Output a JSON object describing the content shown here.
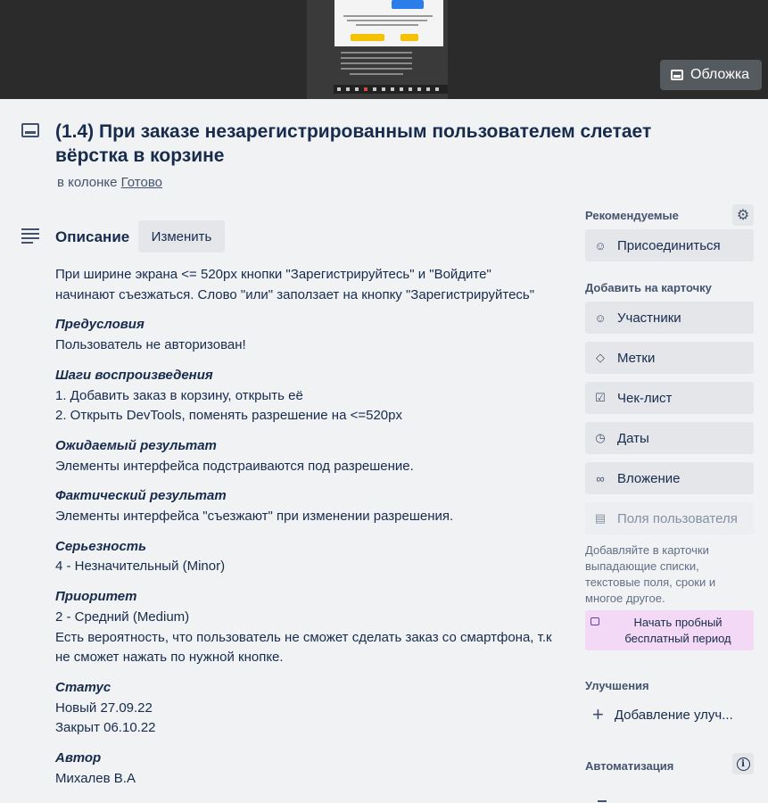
{
  "cover": {
    "button_label": "Обложка",
    "button_icon": "card-cover-icon"
  },
  "card": {
    "title": "(1.4) При заказе незарегистрированным пользователем слетает вёрстка в корзине",
    "in_list_prefix": "в колонке",
    "list_name": "Готово"
  },
  "description": {
    "label": "Описание",
    "edit_label": "Изменить",
    "intro_line1": "При ширине экрана <= 520px кнопки \"Зарегистрируйтесь\" и \"Войдите\"",
    "intro_line2": "начинают съезжаться. Слово \"или\" заползает на кнопку \"Зарегистрируйтесь\"",
    "preconditions_h": "Предусловия",
    "preconditions": "Пользователь не авторизован!",
    "steps_h": "Шаги воспроизведения",
    "step1": "1. Добавить заказ в корзину, открыть её",
    "step2": "2. Открыть DevTools, поменять разрешение на <=520px",
    "expected_h": "Ожидаемый результат",
    "expected": "Элементы интерфейса подстраиваются под разрешение.",
    "actual_h": "Фактический результат",
    "actual": "Элементы интерфейса \"съезжают\" при изменении разрешения.",
    "severity_h": "Серьезность",
    "severity": "4 - Незначительный (Minor)",
    "priority_h": "Приоритет",
    "priority": "2 - Средний (Medium)",
    "priority_note1": "Есть вероятность, что пользователь не сможет сделать заказ со смартфона, т.к",
    "priority_note2": "не сможет нажать по нужной кнопке.",
    "status_h": "Статус",
    "status_new": "Новый 27.09.22",
    "status_closed": "Закрыт 06.10.22",
    "author_h": "Автор",
    "author": "Михалев В.А"
  },
  "sidebar": {
    "suggested_h": "Рекомендуемые",
    "join_label": "Присоединиться",
    "add_to_card_h": "Добавить на карточку",
    "members_label": "Участники",
    "labels_label": "Метки",
    "checklist_label": "Чек-лист",
    "dates_label": "Даты",
    "attachment_label": "Вложение",
    "custom_fields_label": "Поля пользователя",
    "hint": "Добавляйте в карточки выпадающие списки, текстовые поля, сроки и многое другое.",
    "trial_label": "Начать пробный бесплатный период",
    "powerups_h": "Улучшения",
    "add_powerup_label": "Добавление улуч...",
    "automation_h": "Автоматизация"
  }
}
